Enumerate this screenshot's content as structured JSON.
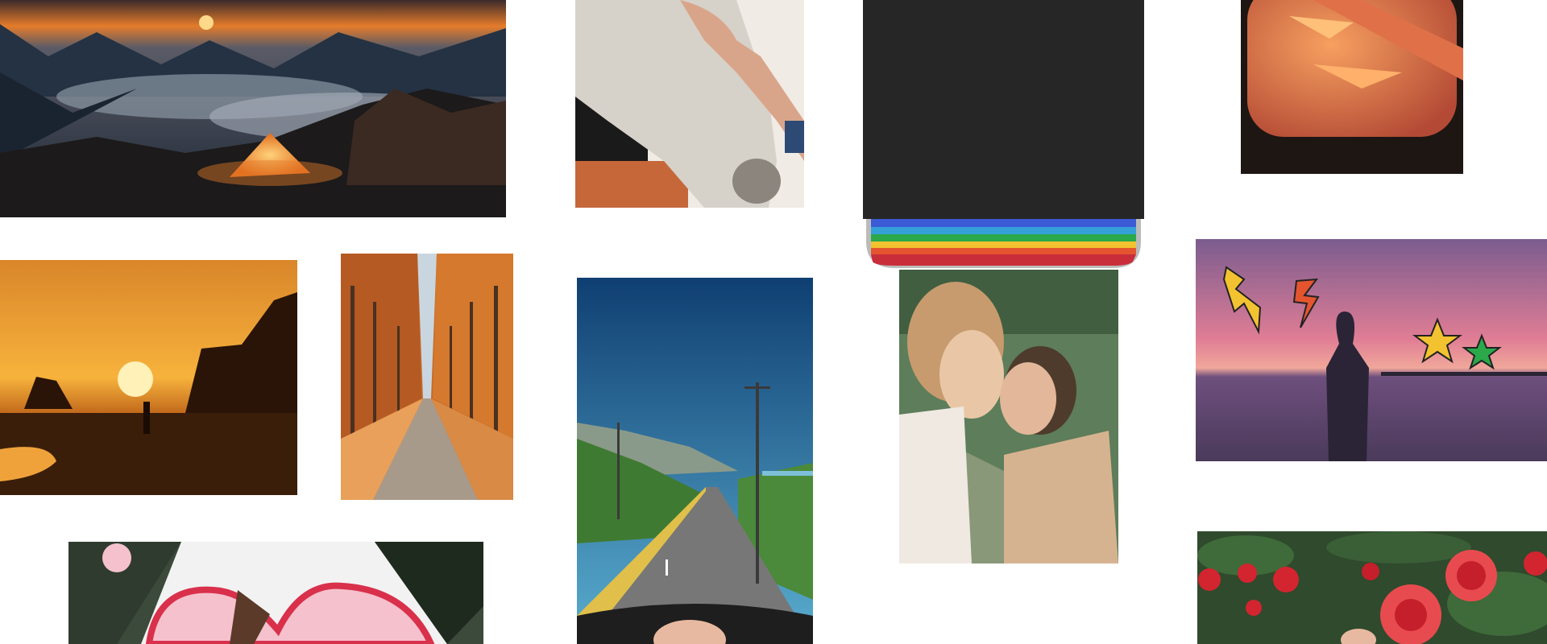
{
  "page": {
    "background": "#ffffff"
  },
  "gallery": {
    "photos": [
      {
        "id": "mountain",
        "icon": "mountain-tent-photo",
        "palette": [
          "#1d2b3a",
          "#e57c2b",
          "#f2a23b"
        ]
      },
      {
        "id": "horse",
        "icon": "white-horse-photo",
        "palette": [
          "#d6d1c9",
          "#f0ebe4",
          "#1a1a1a"
        ]
      },
      {
        "id": "printer",
        "icon": "rainbow-printer-photo",
        "palette": [
          "#262626",
          "#3b5bd6",
          "#2aa84a",
          "#f2c230",
          "#e4552f",
          "#c92d3a"
        ]
      },
      {
        "id": "wing",
        "icon": "airplane-window-photo",
        "palette": [
          "#1e1613",
          "#e07048",
          "#f6a060"
        ]
      },
      {
        "id": "sunset",
        "icon": "beach-sunset-photo",
        "palette": [
          "#f4a62a",
          "#7a3b12",
          "#1b1108"
        ]
      },
      {
        "id": "autumn",
        "icon": "autumn-avenue-photo",
        "palette": [
          "#c46a2a",
          "#e9a05a",
          "#6b4a33"
        ]
      },
      {
        "id": "road",
        "icon": "coastal-road-photo",
        "palette": [
          "#0f4d86",
          "#4e9dc6",
          "#4b8a3a",
          "#777777"
        ]
      },
      {
        "id": "kiss",
        "icon": "couple-kiss-photo",
        "palette": [
          "#5e7d5a",
          "#c79b6e",
          "#efe9e1"
        ]
      },
      {
        "id": "lightning",
        "icon": "lightning-sticker-photo",
        "palette": [
          "#d96c8b",
          "#6e4f7d",
          "#2a2436"
        ]
      },
      {
        "id": "cake",
        "icon": "heart-cake-photo",
        "palette": [
          "#f5c1cd",
          "#d9304b",
          "#3b4a3a"
        ]
      },
      {
        "id": "roses",
        "icon": "red-roses-photo",
        "palette": [
          "#2f4a2c",
          "#d22530",
          "#e84b4f"
        ]
      }
    ]
  }
}
